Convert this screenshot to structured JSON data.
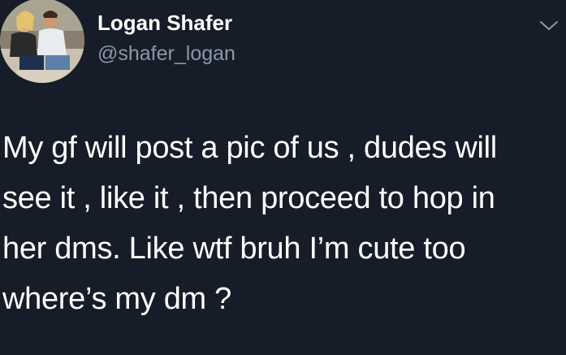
{
  "author": {
    "display_name": "Logan Shafer",
    "handle": "@shafer_logan",
    "avatar_icon": "profile-photo"
  },
  "menu": {
    "icon": "chevron-down-icon"
  },
  "tweet": {
    "lines": [
      "My gf will post a pic of us , dudes will",
      "see it , like it , then proceed to hop in",
      "her dms. Like wtf bruh I’m cute too",
      "where’s my dm ?"
    ]
  },
  "colors": {
    "background": "#161d28",
    "text": "#ffffff",
    "secondary_text": "#8b98a5"
  }
}
